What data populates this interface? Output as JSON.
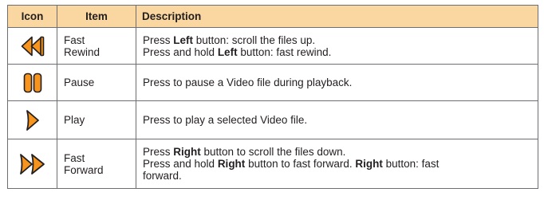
{
  "header": {
    "icon": "Icon",
    "item": "Item",
    "description": "Description"
  },
  "colors": {
    "header_bg": "#fad7a0",
    "icon_orange": "#f7941d",
    "icon_outline": "#231f20",
    "border": "#6d6e71"
  },
  "rows": [
    {
      "icon": "fast-rewind-icon",
      "item_lines": [
        "Fast",
        "Rewind"
      ],
      "desc": [
        {
          "pre": "Press ",
          "bold": "Left",
          "post": " button: scroll the files up."
        },
        {
          "pre": "Press and hold ",
          "bold": "Left",
          "post": " button: fast rewind."
        }
      ]
    },
    {
      "icon": "pause-icon",
      "item_lines": [
        "Pause"
      ],
      "desc": [
        {
          "text": "Press to pause a Video file during playback."
        }
      ]
    },
    {
      "icon": "play-icon",
      "item_lines": [
        "Play"
      ],
      "desc": [
        {
          "text": "Press to play a selected Video file."
        }
      ]
    },
    {
      "icon": "fast-forward-icon",
      "item_lines": [
        "Fast",
        "Forward"
      ],
      "desc": [
        {
          "pre": "Press ",
          "bold": "Right",
          "post": " button to scroll the files down."
        },
        {
          "pre": "Press and hold ",
          "bold": "Right",
          "post": " button to fast forward. ",
          "bold2": "Right",
          "post2": " button: fast"
        },
        {
          "text": "forward."
        }
      ]
    }
  ]
}
